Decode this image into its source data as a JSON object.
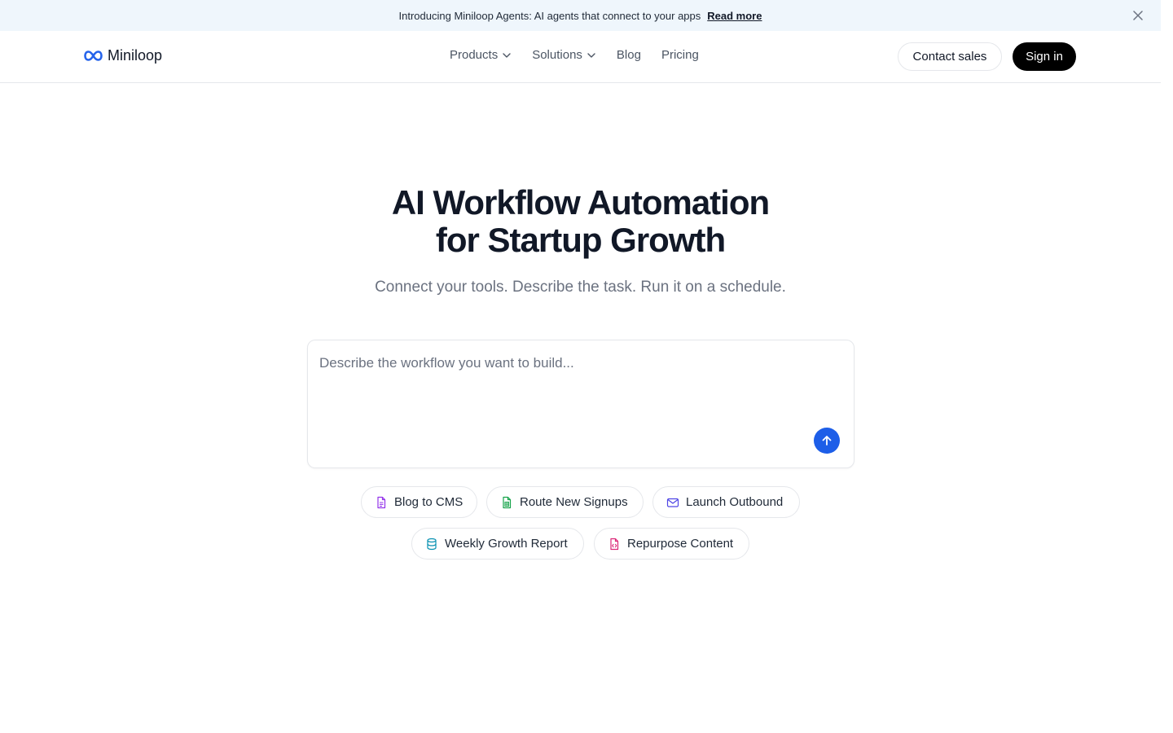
{
  "announcement": {
    "text": "Introducing Miniloop Agents: AI agents that connect to your apps",
    "link": "Read more"
  },
  "brand": {
    "name": "Miniloop",
    "icon": "infinity-icon",
    "color": "#2563eb"
  },
  "nav": {
    "items": [
      {
        "label": "Products",
        "dropdown": true
      },
      {
        "label": "Solutions",
        "dropdown": true
      },
      {
        "label": "Blog",
        "dropdown": false
      },
      {
        "label": "Pricing",
        "dropdown": false
      }
    ],
    "contact": "Contact sales",
    "signin": "Sign in"
  },
  "hero": {
    "title_line1": "AI Workflow Automation",
    "title_line2": "for Startup Growth",
    "subtitle": "Connect your tools. Describe the task. Run it on a schedule."
  },
  "prompt": {
    "placeholder": "Describe the workflow you want to build...",
    "value": "",
    "send_color": "#1d5ee8"
  },
  "suggestions": [
    {
      "label": "Blog to CMS",
      "icon": "document-icon",
      "color": "#9333ea"
    },
    {
      "label": "Route New Signups",
      "icon": "spreadsheet-icon",
      "color": "#16a34a"
    },
    {
      "label": "Launch Outbound",
      "icon": "mail-icon",
      "color": "#4f46e5"
    },
    {
      "label": "Weekly Growth Report",
      "icon": "database-icon",
      "color": "#0891b2"
    },
    {
      "label": "Repurpose Content",
      "icon": "code-file-icon",
      "color": "#db2777"
    }
  ]
}
